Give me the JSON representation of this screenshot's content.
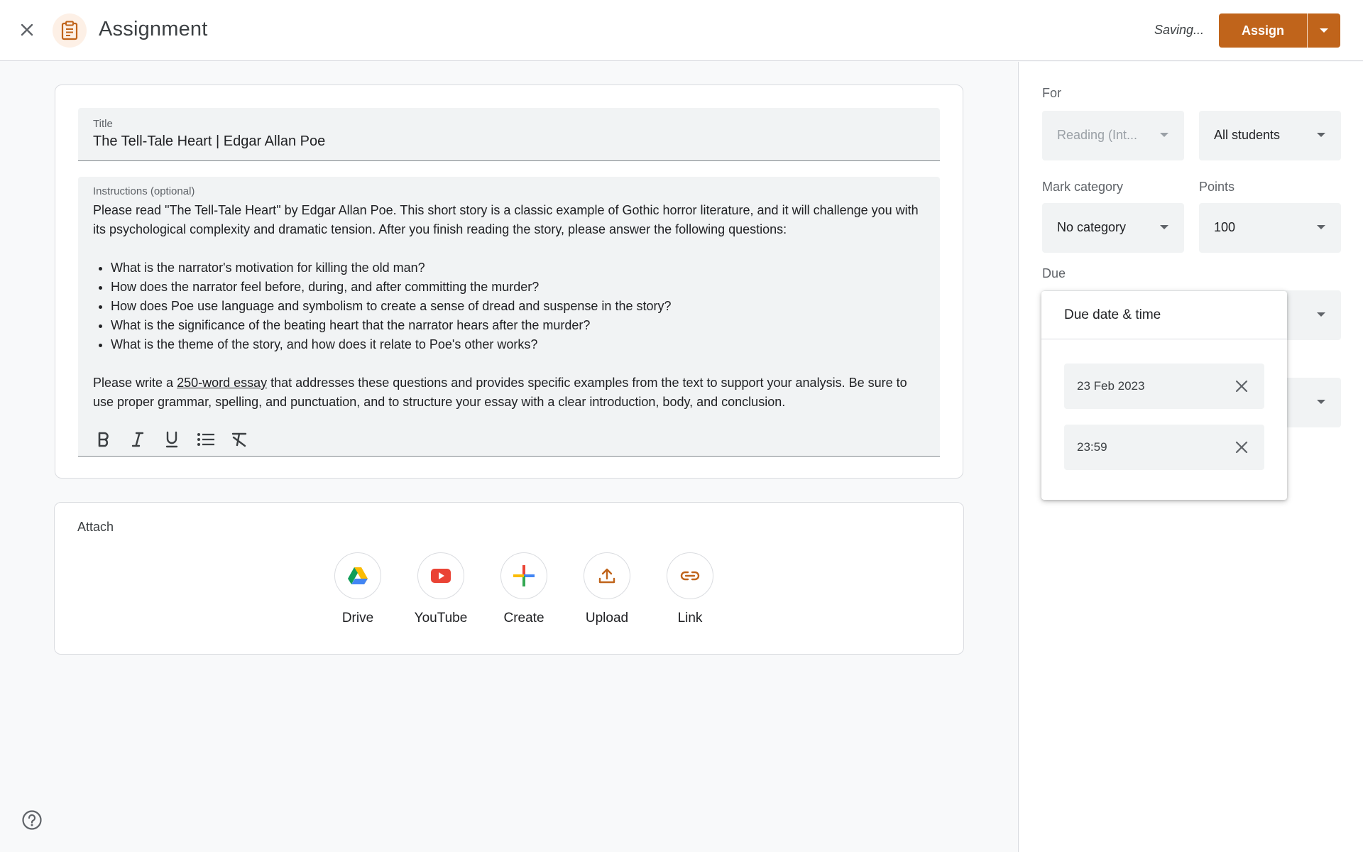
{
  "header": {
    "title": "Assignment",
    "status": "Saving...",
    "assign_label": "Assign",
    "accent_color": "#c0641b"
  },
  "details": {
    "title_label": "Title",
    "title_value": "The Tell-Tale Heart | Edgar Allan Poe",
    "instructions_label": "Instructions (optional)",
    "instructions_intro": "Please read \"The Tell-Tale Heart\" by Edgar Allan Poe. This short story is a classic example of Gothic horror literature, and it will challenge you with its psychological complexity and dramatic tension. After you finish reading the story, please answer the following questions:",
    "questions": [
      "What is the narrator's motivation for killing the old man?",
      "How does the narrator feel before, during, and after committing the murder?",
      "How does Poe use language and symbolism to create a sense of dread and suspense in the story?",
      "What is the significance of the beating heart that the narrator hears after the murder?",
      "What is the theme of the story, and how does it relate to Poe's other works?"
    ],
    "closing_pre": "Please write a ",
    "closing_link": "250-word essay",
    "closing_post": " that addresses these questions and provides specific examples from the text to support your analysis. Be sure to use proper grammar, spelling, and punctuation, and to structure your essay with a clear introduction, body, and conclusion.",
    "format_tools": [
      "bold-icon",
      "italic-icon",
      "underline-icon",
      "bulleted-list-icon",
      "clear-formatting-icon"
    ]
  },
  "attach": {
    "label": "Attach",
    "items": [
      {
        "label": "Drive",
        "icon": "drive-icon"
      },
      {
        "label": "YouTube",
        "icon": "youtube-icon"
      },
      {
        "label": "Create",
        "icon": "create-icon"
      },
      {
        "label": "Upload",
        "icon": "upload-icon"
      },
      {
        "label": "Link",
        "icon": "link-icon"
      }
    ]
  },
  "side": {
    "for_label": "For",
    "class_value": "Reading (Int...",
    "students_value": "All students",
    "category_label": "Mark category",
    "category_value": "No category",
    "points_label": "Points",
    "points_value": "100",
    "due_label": "Due"
  },
  "due_popup": {
    "title": "Due date & time",
    "date_value": "23 Feb 2023",
    "time_value": "23:59"
  }
}
